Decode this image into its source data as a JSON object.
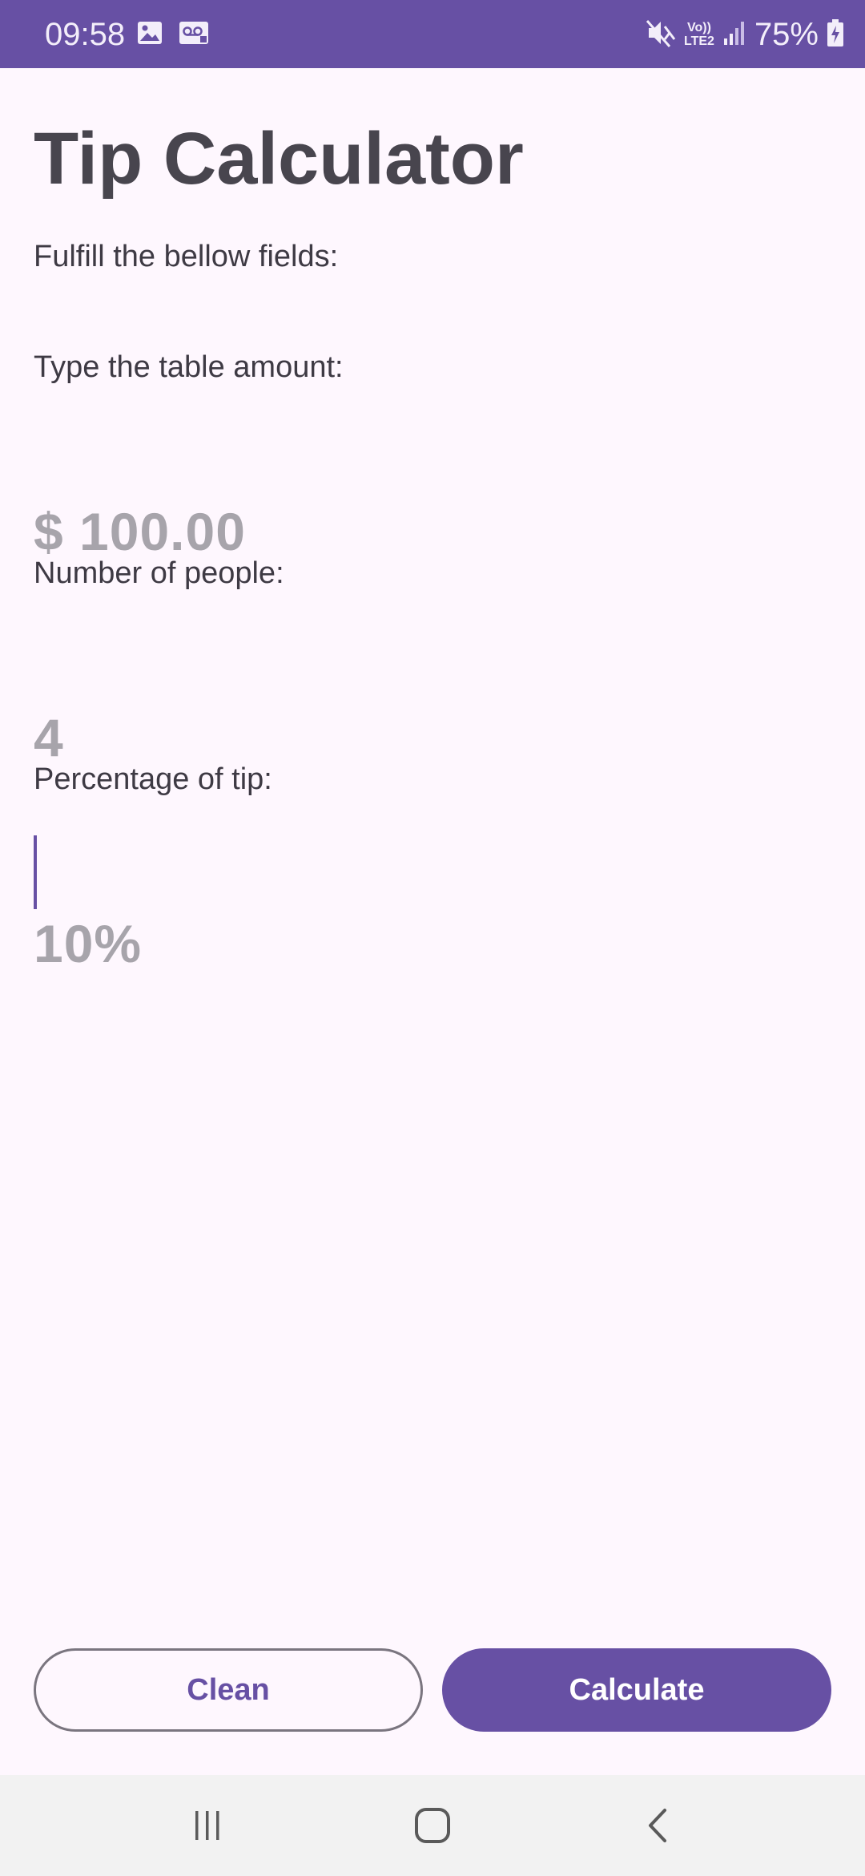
{
  "status_bar": {
    "time": "09:58",
    "left_icons": [
      "image-icon",
      "voicemail-icon"
    ],
    "right_icons": [
      "mute-icon",
      "volte-lte2-icon",
      "signal-icon",
      "battery-charging-icon"
    ],
    "lte_line1": "Vo))",
    "lte_line2": "LTE2",
    "battery": "75%"
  },
  "app": {
    "title": "Tip Calculator",
    "subtitle": "Fulfill the bellow fields:"
  },
  "form": {
    "amount": {
      "label": "Type the table amount:",
      "placeholder": "$ 100.00",
      "value": ""
    },
    "people": {
      "label": "Number of people:",
      "placeholder": "4",
      "value": ""
    },
    "tip": {
      "label": "Percentage of tip:",
      "placeholder": "10%",
      "value": "",
      "focused": true
    }
  },
  "buttons": {
    "clean": "Clean",
    "calculate": "Calculate"
  },
  "nav_bar": {
    "icons": [
      "recents-icon",
      "home-icon",
      "back-icon"
    ]
  },
  "colors": {
    "primary": "#6750a4",
    "background": "#fef7fe",
    "text": "#48454e",
    "placeholder": "#a7a4ab",
    "nav_background": "#f2f2f2"
  }
}
